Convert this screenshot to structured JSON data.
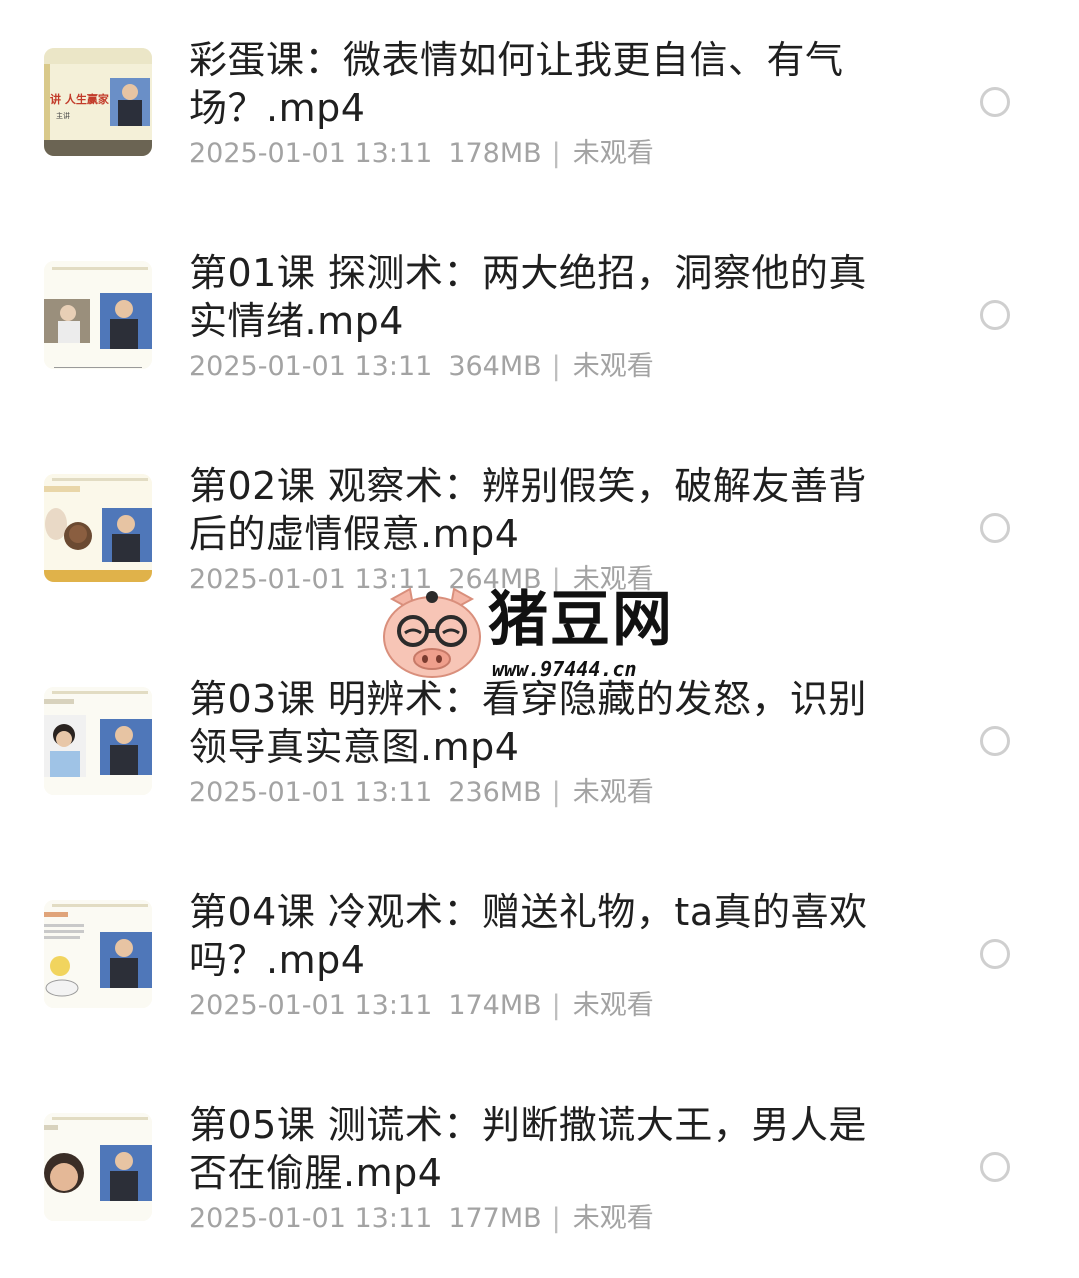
{
  "files": [
    {
      "title": "彩蛋课：微表情如何让我更自信、有气场？.mp4",
      "date": "2025-01-01 13:11",
      "size": "178MB",
      "status": "未观看",
      "thumb_caption": "讲  人生赢家",
      "thumb_sub": "主讲"
    },
    {
      "title": "第01课 探测术：两大绝招，洞察他的真实情绪.mp4",
      "date": "2025-01-01 13:11",
      "size": "364MB",
      "status": "未观看"
    },
    {
      "title": "第02课 观察术：辨别假笑，破解友善背后的虚情假意.mp4",
      "date": "2025-01-01 13:11",
      "size": "264MB",
      "status": "未观看"
    },
    {
      "title": "第03课 明辨术：看穿隐藏的发怒，识别领导真实意图.mp4",
      "date": "2025-01-01 13:11",
      "size": "236MB",
      "status": "未观看"
    },
    {
      "title": "第04课 冷观术：赠送礼物，ta真的喜欢吗？.mp4",
      "date": "2025-01-01 13:11",
      "size": "174MB",
      "status": "未观看"
    },
    {
      "title": "第05课 测谎术：判断撒谎大王，男人是否在偷腥.mp4",
      "date": "2025-01-01 13:11",
      "size": "177MB",
      "status": "未观看"
    }
  ],
  "separator": "|",
  "watermark": {
    "name": "猪豆网",
    "url": "www.97444.cn"
  },
  "colors": {
    "title": "#1f1f1f",
    "meta": "#a3a3a3",
    "radio_border": "#cfcfcf",
    "thumb_bg": "#f6f3e6",
    "pig_pink": "#f4b6a6"
  }
}
